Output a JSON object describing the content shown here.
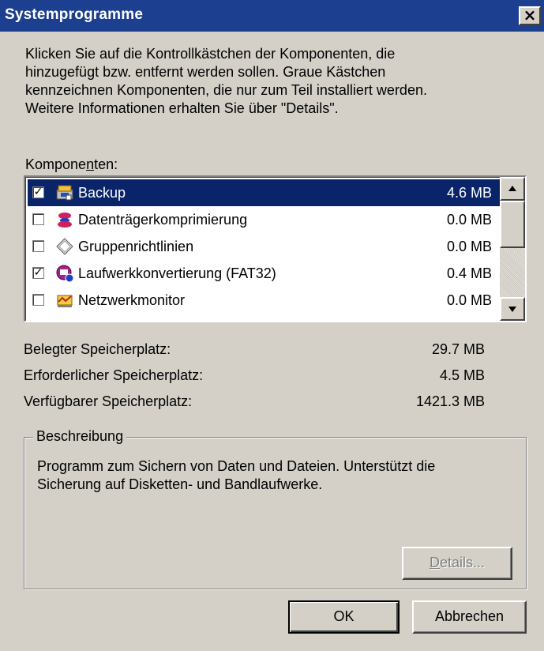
{
  "window": {
    "title": "Systemprogramme",
    "close_glyph": "×"
  },
  "intro": {
    "lines": [
      "Klicken Sie auf die Kontrollkästchen der Komponenten, die",
      "hinzugefügt bzw. entfernt werden sollen. Graue Kästchen",
      "kennzeichnen Komponenten, die nur zum Teil installiert werden.",
      "Weitere Informationen erhalten Sie über \"Details\"."
    ]
  },
  "components": {
    "label_pre": "Kompone",
    "label_accel": "n",
    "label_post": "ten:",
    "items": [
      {
        "name": "Backup",
        "size": "4.6 MB",
        "checked": true,
        "selected": true,
        "icon": "backup-icon"
      },
      {
        "name": "Datenträgerkomprimierung",
        "size": "0.0 MB",
        "checked": false,
        "selected": false,
        "icon": "compression-icon"
      },
      {
        "name": "Gruppenrichtlinien",
        "size": "0.0 MB",
        "checked": false,
        "selected": false,
        "icon": "group-policy-icon"
      },
      {
        "name": "Laufwerkkonvertierung (FAT32)",
        "size": "0.4 MB",
        "checked": true,
        "selected": false,
        "icon": "drive-converter-icon"
      },
      {
        "name": "Netzwerkmonitor",
        "size": "0.0 MB",
        "checked": false,
        "selected": false,
        "icon": "network-monitor-icon"
      }
    ],
    "checkmark": "✓"
  },
  "space": {
    "used_label": "Belegter Speicherplatz:",
    "used_value": "29.7 MB",
    "required_label": "Erforderlicher Speicherplatz:",
    "required_value": "4.5 MB",
    "available_label": "Verfügbarer Speicherplatz:",
    "available_value": "1421.3 MB"
  },
  "description": {
    "group_label": "Beschreibung",
    "lines": [
      "Programm zum Sichern von Daten und Dateien. Unterstützt die",
      "Sicherung auf Disketten- und Bandlaufwerke."
    ],
    "details_accel": "D",
    "details_rest": "etails..."
  },
  "buttons": {
    "ok": "OK",
    "cancel": "Abbrechen"
  },
  "colors": {
    "titlebar": "#1c3f8f",
    "selection": "#0a246a",
    "face": "#d4d0c8"
  }
}
